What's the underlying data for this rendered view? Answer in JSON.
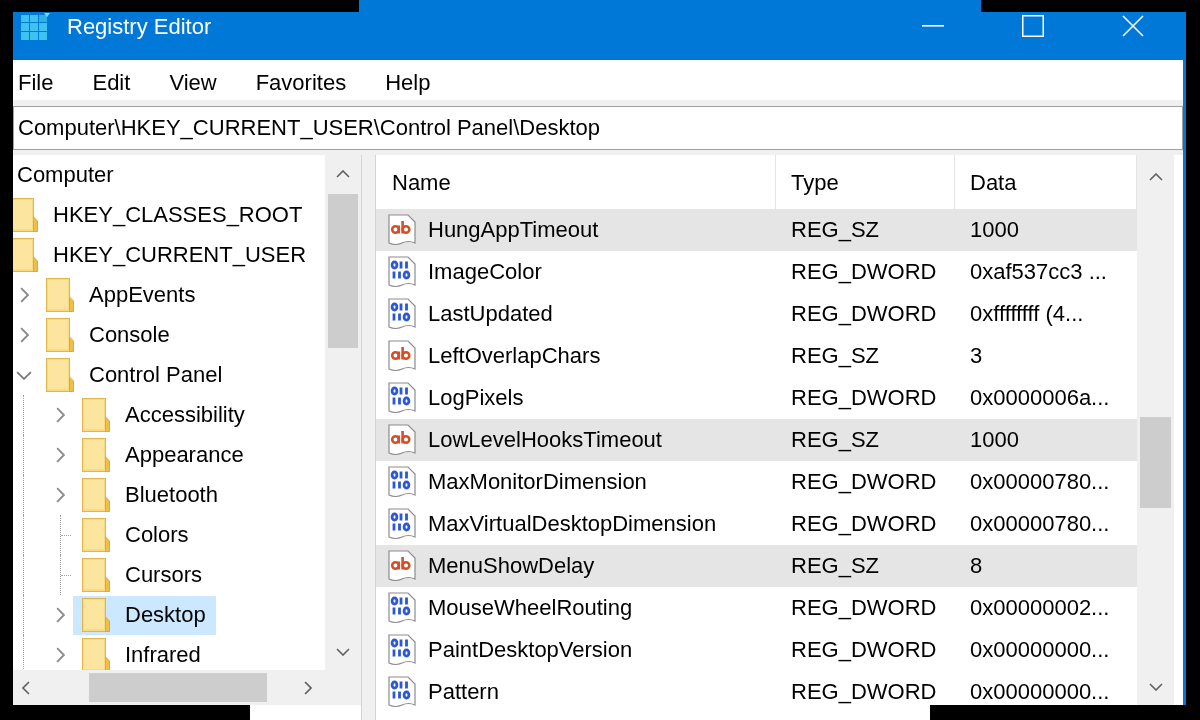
{
  "window": {
    "title": "Registry Editor"
  },
  "menu": [
    "File",
    "Edit",
    "View",
    "Favorites",
    "Help"
  ],
  "address_bar": {
    "value": "Computer\\HKEY_CURRENT_USER\\Control Panel\\Desktop"
  },
  "tree": {
    "label": "Computer",
    "selected": false,
    "children": [
      {
        "label": "HKEY_CLASSES_ROOT",
        "selected": false
      },
      {
        "label": "HKEY_CURRENT_USER",
        "selected": false,
        "children": [
          {
            "label": "AppEvents",
            "has_subkeys": true,
            "expanded": false,
            "selected": false
          },
          {
            "label": "Console",
            "has_subkeys": true,
            "expanded": false,
            "selected": false
          },
          {
            "label": "Control Panel",
            "has_subkeys": true,
            "expanded": true,
            "selected": false,
            "children": [
              {
                "label": "Accessibility",
                "has_subkeys": true,
                "expanded": false,
                "selected": false
              },
              {
                "label": "Appearance",
                "has_subkeys": true,
                "expanded": false,
                "selected": false
              },
              {
                "label": "Bluetooth",
                "has_subkeys": true,
                "expanded": false,
                "selected": false
              },
              {
                "label": "Colors",
                "has_subkeys": false,
                "expanded": false,
                "selected": false
              },
              {
                "label": "Cursors",
                "has_subkeys": false,
                "expanded": false,
                "selected": false
              },
              {
                "label": "Desktop",
                "has_subkeys": true,
                "expanded": false,
                "selected": true
              },
              {
                "label": "Infrared",
                "has_subkeys": true,
                "expanded": false,
                "selected": false
              }
            ]
          }
        ]
      }
    ]
  },
  "values": {
    "columns": [
      "Name",
      "Type",
      "Data"
    ],
    "rows": [
      {
        "kind": "string",
        "name": "HungAppTimeout",
        "type": "REG_SZ",
        "data": "1000",
        "highlighted": true
      },
      {
        "kind": "binary",
        "name": "ImageColor",
        "type": "REG_DWORD",
        "data": "0xaf537cc3 ...",
        "highlighted": false
      },
      {
        "kind": "binary",
        "name": "LastUpdated",
        "type": "REG_DWORD",
        "data": "0xffffffff (4...",
        "highlighted": false
      },
      {
        "kind": "string",
        "name": "LeftOverlapChars",
        "type": "REG_SZ",
        "data": "3",
        "highlighted": false
      },
      {
        "kind": "binary",
        "name": "LogPixels",
        "type": "REG_DWORD",
        "data": "0x0000006a...",
        "highlighted": false
      },
      {
        "kind": "string",
        "name": "LowLevelHooksTimeout",
        "type": "REG_SZ",
        "data": "1000",
        "highlighted": true
      },
      {
        "kind": "binary",
        "name": "MaxMonitorDimension",
        "type": "REG_DWORD",
        "data": "0x00000780...",
        "highlighted": false
      },
      {
        "kind": "binary",
        "name": "MaxVirtualDesktopDimension",
        "type": "REG_DWORD",
        "data": "0x00000780...",
        "highlighted": false
      },
      {
        "kind": "string",
        "name": "MenuShowDelay",
        "type": "REG_SZ",
        "data": "8",
        "highlighted": true
      },
      {
        "kind": "binary",
        "name": "MouseWheelRouting",
        "type": "REG_DWORD",
        "data": "0x00000002...",
        "highlighted": false
      },
      {
        "kind": "binary",
        "name": "PaintDesktopVersion",
        "type": "REG_DWORD",
        "data": "0x00000000...",
        "highlighted": false
      },
      {
        "kind": "binary",
        "name": "Pattern",
        "type": "REG_DWORD",
        "data": "0x00000000...",
        "highlighted": false
      }
    ]
  }
}
